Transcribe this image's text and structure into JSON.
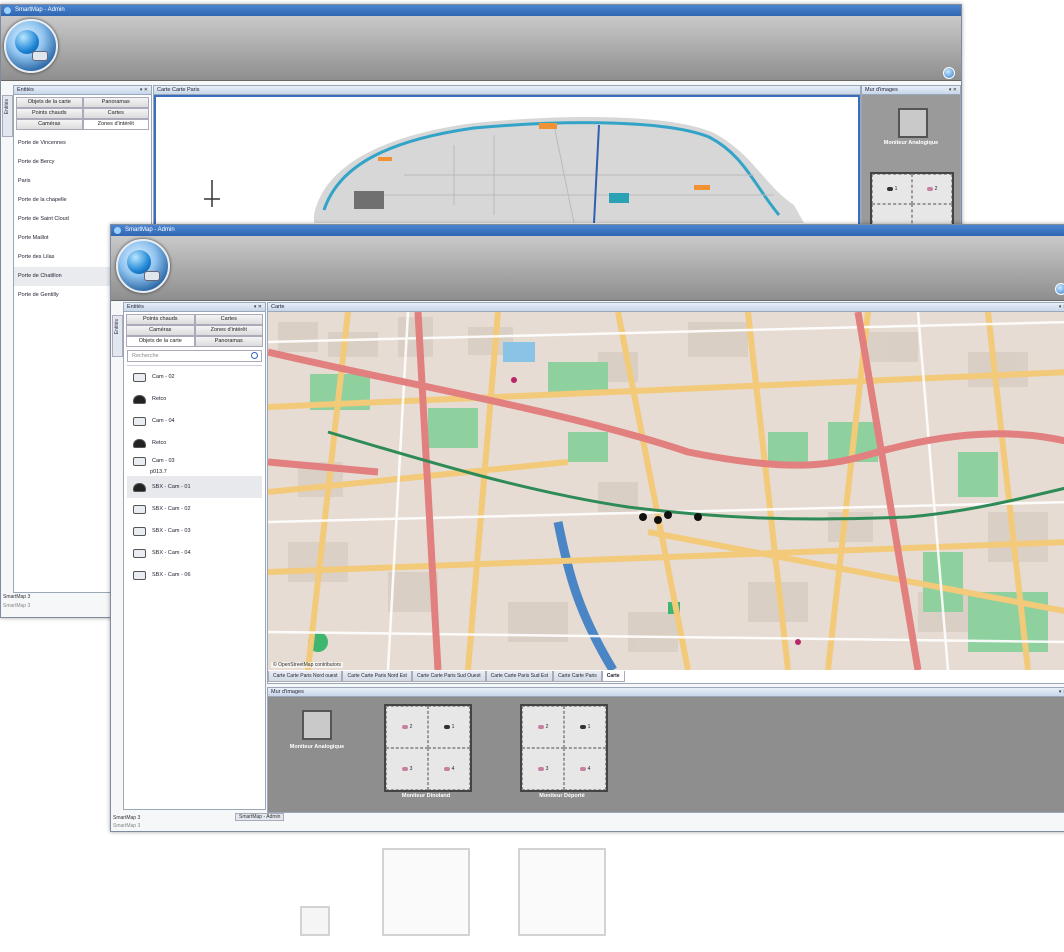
{
  "back_window": {
    "title": "SmartMap - Admin",
    "entities_panel": {
      "title": "Entités",
      "tabs": [
        "Objets de la carte",
        "Panoramas",
        "Points chauds",
        "Cartes",
        "Caméras",
        "Zones d'intérêt"
      ],
      "items": [
        "Porte de Vincennes",
        "Porte de Bercy",
        "Paris",
        "Porte de la chapelle",
        "Porte de Saint Cloud",
        "Porte Maillot",
        "Porte des Lilas",
        "Porte de Chatillon",
        "Porte de Gentilly"
      ],
      "selected_index": 7
    },
    "map_panel": {
      "title": "Carte Carte Paris"
    },
    "wall_panel": {
      "title": "Mur d'images",
      "monitor_label": "Moniteur Analogique"
    },
    "side_tab": "Entités",
    "status_text": "SmartMap 3",
    "status_sub": "SmartMap 3"
  },
  "front_window": {
    "title": "SmartMap - Admin",
    "side_tab": "Entités",
    "entities_panel": {
      "title": "Entités",
      "tabs": [
        "Points chauds",
        "Cartes",
        "Caméras",
        "Zones d'intérêt",
        "Objets de la carte",
        "Panoramas"
      ],
      "search_placeholder": "Recherche",
      "cameras": [
        {
          "label": "Cam - 02",
          "type": "box"
        },
        {
          "label": "Retco",
          "type": "dome"
        },
        {
          "label": "Cam - 04",
          "type": "box"
        },
        {
          "label": "Retco",
          "type": "dome"
        },
        {
          "label": "Cam - 03",
          "type": "box"
        },
        {
          "label": "p013.7",
          "type": "none"
        },
        {
          "label": "SBX - Cam - 01",
          "type": "dome"
        },
        {
          "label": "SBX - Cam - 02",
          "type": "box"
        },
        {
          "label": "SBX - Cam - 03",
          "type": "box"
        },
        {
          "label": "SBX - Cam - 04",
          "type": "box"
        },
        {
          "label": "SBX - Cam - 06",
          "type": "box"
        }
      ],
      "selected_index": 6
    },
    "map_panel": {
      "title": "Carte",
      "attribution": "© OpenStreetMap contributors",
      "tabs": [
        "Carte Carte Paris Nord ouest",
        "Carte Carte Paris Nord Est",
        "Carte Carte Paris Sud Ouest",
        "Carte Carte Paris Sud Est",
        "Carte Carte Paris",
        "Carte"
      ],
      "active_tab": 5
    },
    "wall_panel": {
      "title": "Mur d'images",
      "monitors": [
        {
          "label": "Moniteur Analogique",
          "kind": "single"
        },
        {
          "label": "Moniteur Dinoland",
          "kind": "grid",
          "cells": [
            "2",
            "1",
            "3",
            "4"
          ]
        },
        {
          "label": "Moniteur Déporté",
          "kind": "grid",
          "cells": [
            "2",
            "1",
            "3",
            "4"
          ]
        }
      ]
    },
    "status_text": "SmartMap 3",
    "status_sub": "SmartMap 3",
    "taskbar_item": "SmartMap - Admin"
  },
  "colors": {
    "title_bar": "#2f66b3",
    "ribbon": "#a9a9a9",
    "wall_bg": "#8e8e8e",
    "map_water": "#4a86c5",
    "map_park": "#7ec98f",
    "map_main_road": "#e07a7a",
    "map_secondary_road": "#f2c87a",
    "map_rail": "#2e8b57"
  }
}
